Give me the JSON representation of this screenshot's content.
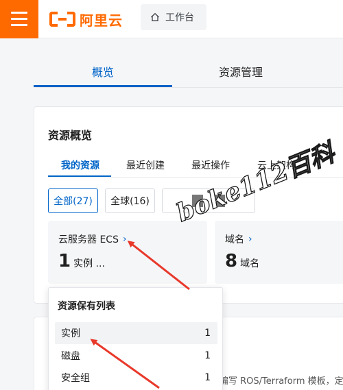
{
  "brand": {
    "logo_text": "阿里云"
  },
  "header": {
    "workbench_label": "工作台"
  },
  "main_tabs": [
    {
      "label": "概览",
      "active": true
    },
    {
      "label": "资源管理",
      "active": false
    }
  ],
  "overview": {
    "title": "资源概览",
    "sub_tabs": [
      {
        "label": "我的资源",
        "active": true
      },
      {
        "label": "最近创建",
        "active": false
      },
      {
        "label": "最近操作",
        "active": false
      },
      {
        "label": "云上架构",
        "active": false
      }
    ],
    "filters": [
      {
        "label": "全部(27)",
        "active": true
      },
      {
        "label": "全球(16)",
        "active": false
      }
    ],
    "resources": [
      {
        "name": "云服务器 ECS",
        "count": "1",
        "unit": "实例 ..."
      },
      {
        "name": "域名",
        "count": "8",
        "unit": "域名"
      }
    ]
  },
  "popup": {
    "title": "资源保有列表",
    "rows": [
      {
        "label": "实例",
        "value": "1",
        "active": true
      },
      {
        "label": "磁盘",
        "value": "1",
        "active": false
      },
      {
        "label": "安全组",
        "value": "1",
        "active": false
      }
    ]
  },
  "card2": {
    "text": "编写 ROS/Terraform 模板，定"
  },
  "watermark": {
    "text": "boke112百科"
  },
  "colors": {
    "accent": "#0064c8",
    "brand": "#ff6a00",
    "arrow": "#e8392b"
  }
}
